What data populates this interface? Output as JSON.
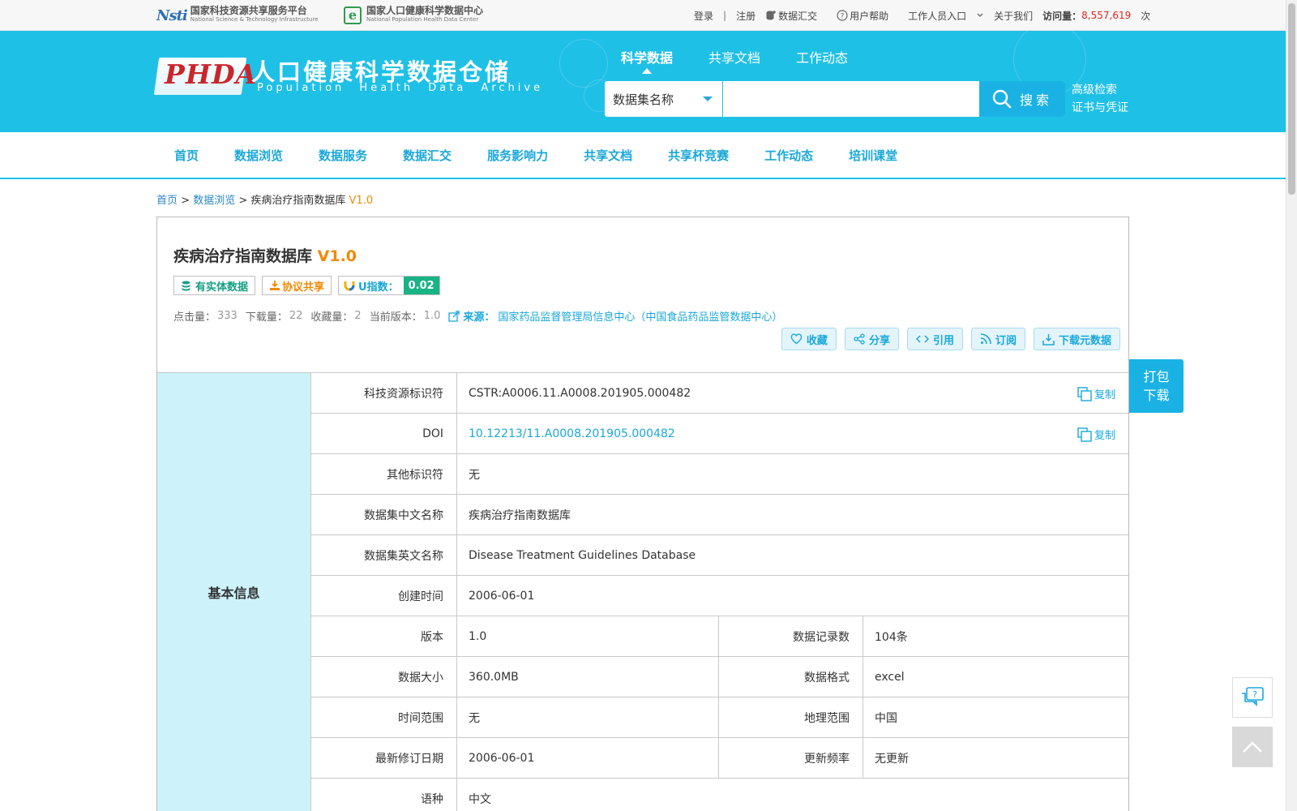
{
  "topbar": {
    "nsti_cn": "国家科技资源共享服务平台",
    "nsti_en": "National Science & Technology Infrastructure",
    "npc_cn": "国家人口健康科学数据中心",
    "npc_en": "National Population Health Data Center",
    "login": "登录",
    "sep": "|",
    "register": "注册",
    "data_submit": "数据汇交",
    "help": "用户帮助",
    "staff_entry": "工作人员入口",
    "about": "关于我们",
    "visits_label": "访问量：",
    "visits_count": "8,557,619",
    "visits_unit": "次"
  },
  "header": {
    "logo_abbr": "PHDA",
    "title": "人口健康科学数据仓储",
    "subtitle": "Population Health Data Archive",
    "tabs": [
      {
        "label": "科学数据",
        "active": true
      },
      {
        "label": "共享文档",
        "active": false
      },
      {
        "label": "工作动态",
        "active": false
      }
    ],
    "search": {
      "select_value": "数据集名称",
      "input_value": "",
      "button": "搜索"
    },
    "advanced_search": "高级检索",
    "certificate": "证书与凭证"
  },
  "mainnav": {
    "items": [
      "首页",
      "数据浏览",
      "数据服务",
      "数据汇交",
      "服务影响力",
      "共享文档",
      "共享杯竞赛",
      "工作动态",
      "培训课堂"
    ]
  },
  "breadcrumb": {
    "home": "首页",
    "browse": "数据浏览",
    "current": "疾病治疗指南数据库",
    "version": "V1.0"
  },
  "dataset": {
    "name": "疾病治疗指南数据库",
    "version": "V1.0",
    "badges": {
      "has_data": "有实体数据",
      "agreement": "协议共享",
      "u_index_label": "U指数：",
      "u_index": "0.02"
    },
    "stats": {
      "clicks_label": "点击量：",
      "clicks": "333",
      "downloads_label": "下载量：",
      "downloads": "22",
      "favorites_label": "收藏量：",
      "favorites": "2",
      "current_version_label": "当前版本：",
      "current_version": "1.0",
      "source_label": "来源：",
      "source": "国家药品监督管理局信息中心（中国食品药品监管数据中心）"
    },
    "actions": {
      "favorite": "收藏",
      "share": "分享",
      "cite": "引用",
      "subscribe": "订阅",
      "download_meta": "下载元数据"
    }
  },
  "info": {
    "section": "基本信息",
    "copy": "复制",
    "rows": {
      "cstr_k": "科技资源标识符",
      "cstr_v": "CSTR:A0006.11.A0008.201905.000482",
      "doi_k": "DOI",
      "doi_v": "10.12213/11.A0008.201905.000482",
      "other_k": "其他标识符",
      "other_v": "无",
      "cn_name_k": "数据集中文名称",
      "cn_name_v": "疾病治疗指南数据库",
      "en_name_k": "数据集英文名称",
      "en_name_v": "Disease Treatment Guidelines Database",
      "created_k": "创建时间",
      "created_v": "2006-06-01",
      "version_k": "版本",
      "version_v": "1.0",
      "records_k": "数据记录数",
      "records_v": "104条",
      "size_k": "数据大小",
      "size_v": "360.0MB",
      "format_k": "数据格式",
      "format_v": "excel",
      "time_range_k": "时间范围",
      "time_range_v": "无",
      "geo_range_k": "地理范围",
      "geo_range_v": "中国",
      "revised_k": "最新修订日期",
      "revised_v": "2006-06-01",
      "freq_k": "更新频率",
      "freq_v": "无更新",
      "lang_k": "语种",
      "lang_v": "中文"
    }
  },
  "float": {
    "pack_line1": "打包",
    "pack_line2": "下载"
  },
  "colors": {
    "brand": "#1fc0e6",
    "link": "#1aa8d9",
    "accent_orange": "#ef8a05",
    "side_bg": "#cdf2fa"
  }
}
